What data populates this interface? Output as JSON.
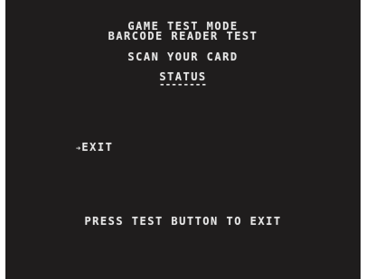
{
  "screen": {
    "title_line_1": "GAME TEST MODE",
    "title_line_2": "BARCODE READER TEST",
    "instruction": "SCAN YOUR CARD",
    "status_label": "STATUS",
    "status_value": "--------",
    "menu": {
      "cursor": "➔",
      "selected_item": "EXIT"
    },
    "footer": "PRESS TEST BUTTON TO EXIT"
  },
  "colors": {
    "background": "#1f1d1d",
    "text": "#e6e6e6",
    "frame": "#ffffff"
  }
}
